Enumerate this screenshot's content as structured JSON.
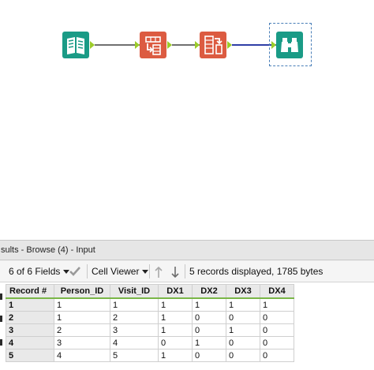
{
  "results": {
    "title": "sults - Browse (4) - Input",
    "toolbar": {
      "fields_label": "6 of 6 Fields",
      "viewer_label": "Cell Viewer",
      "status": "5 records displayed, 1785 bytes"
    },
    "table": {
      "headers": [
        "Record #",
        "Person_ID",
        "Visit_ID",
        "DX1",
        "DX2",
        "DX3",
        "DX4"
      ],
      "rows": [
        [
          "1",
          "1",
          "1",
          "1",
          "1",
          "1",
          "1"
        ],
        [
          "2",
          "1",
          "2",
          "1",
          "0",
          "0",
          "0"
        ],
        [
          "3",
          "2",
          "3",
          "1",
          "0",
          "1",
          "0"
        ],
        [
          "4",
          "3",
          "4",
          "0",
          "1",
          "0",
          "0"
        ],
        [
          "5",
          "4",
          "5",
          "1",
          "0",
          "0",
          "0"
        ]
      ]
    }
  },
  "icons": {
    "input": "book-icon",
    "tool1": "transpose-icon",
    "tool2": "summarize-icon",
    "browse": "binoculars-icon",
    "apply": "checkmark-icon",
    "up": "arrow-up-icon",
    "down": "arrow-down-icon"
  },
  "colors": {
    "input_tool": "#1a9b86",
    "transform_tool": "#dc5b41",
    "anchor": "#9ccc2a",
    "selected_connection": "#2f3ea6",
    "header_underline": "#7ab648"
  }
}
